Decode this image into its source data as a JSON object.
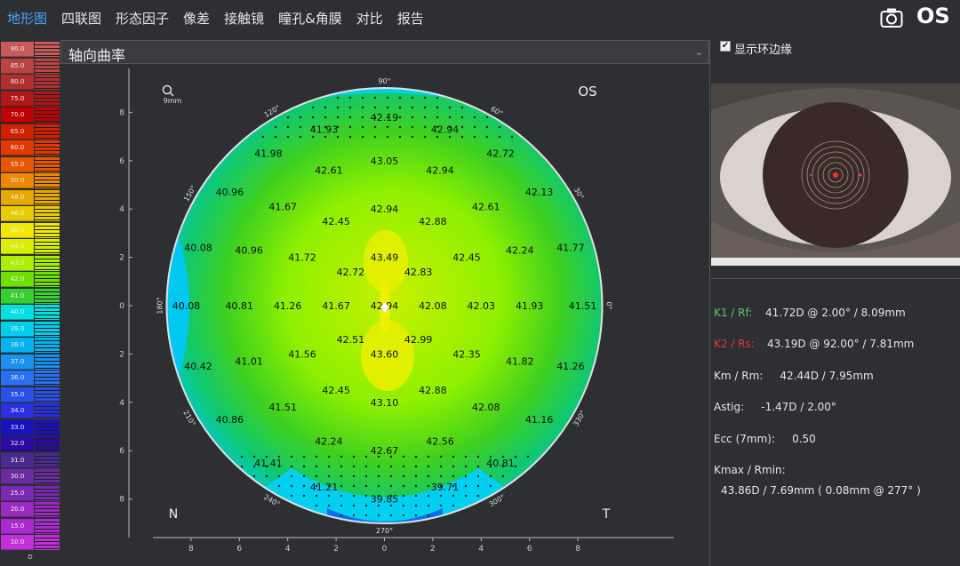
{
  "tabs": [
    "地形图",
    "四联图",
    "形态因子",
    "像差",
    "接触镜",
    "瞳孔&角膜",
    "对比",
    "报告"
  ],
  "active_tab": 0,
  "eye": "OS",
  "scale": {
    "labels": [
      "90.0",
      "85.0",
      "80.0",
      "75.0",
      "70.0",
      "65.0",
      "60.0",
      "55.0",
      "50.0",
      "48.0",
      "46.0",
      "45.0",
      "44.0",
      "43.0",
      "42.0",
      "41.0",
      "40.0",
      "39.0",
      "38.0",
      "37.0",
      "36.0",
      "35.0",
      "34.0",
      "33.0",
      "32.0",
      "31.0",
      "30.0",
      "25.0",
      "20.0",
      "15.0",
      "10.0"
    ],
    "colors": [
      "#c85a5a",
      "#b84444",
      "#b03030",
      "#b01818",
      "#c00000",
      "#d02000",
      "#e03a00",
      "#e65800",
      "#ee8800",
      "#e8a800",
      "#e8cc00",
      "#f0e800",
      "#d8f000",
      "#a8f000",
      "#70e000",
      "#38d030",
      "#00e0e0",
      "#00d0f0",
      "#00b4f0",
      "#1a90f0",
      "#2a70f0",
      "#2a50e8",
      "#2a30e0",
      "#1a10c0",
      "#2a0aa0",
      "#4a2a90",
      "#6a2aa0",
      "#7a2ab0",
      "#9a2ac0",
      "#aa2ad0",
      "#c030d8"
    ],
    "unit": "D"
  },
  "map_type": "轴向曲率",
  "map": {
    "eye": "OS",
    "zoom_label": "9mm",
    "nasal": "N",
    "temporal": "T",
    "angle_labels": [
      "90°",
      "60°",
      "30°",
      "0°",
      "330°",
      "300°",
      "270°",
      "240°",
      "210°",
      "180°",
      "150°",
      "120°"
    ],
    "axis_ticks": [
      "8",
      "6",
      "4",
      "2",
      "0",
      "2",
      "4",
      "6",
      "8"
    ],
    "values": [
      {
        "v": "42.19",
        "x": 0.0,
        "y": 7.8
      },
      {
        "v": "41.93",
        "x": -2.5,
        "y": 7.3
      },
      {
        "v": "42.94",
        "x": 2.5,
        "y": 7.3
      },
      {
        "v": "41.98",
        "x": -4.8,
        "y": 6.3
      },
      {
        "v": "42.72",
        "x": 4.8,
        "y": 6.3
      },
      {
        "v": "43.05",
        "x": 0.0,
        "y": 6.0
      },
      {
        "v": "42.61",
        "x": -2.3,
        "y": 5.6
      },
      {
        "v": "42.94",
        "x": 2.3,
        "y": 5.6
      },
      {
        "v": "40.96",
        "x": -6.4,
        "y": 4.7
      },
      {
        "v": "42.13",
        "x": 6.4,
        "y": 4.7
      },
      {
        "v": "41.67",
        "x": -4.2,
        "y": 4.1
      },
      {
        "v": "42.61",
        "x": 4.2,
        "y": 4.1
      },
      {
        "v": "42.94",
        "x": 0.0,
        "y": 4.0
      },
      {
        "v": "42.45",
        "x": -2.0,
        "y": 3.5
      },
      {
        "v": "42.88",
        "x": 2.0,
        "y": 3.5
      },
      {
        "v": "40.08",
        "x": -7.7,
        "y": 2.4
      },
      {
        "v": "40.96",
        "x": -5.6,
        "y": 2.3
      },
      {
        "v": "41.72",
        "x": -3.4,
        "y": 2.0
      },
      {
        "v": "43.49",
        "x": 0.0,
        "y": 2.0
      },
      {
        "v": "42.45",
        "x": 3.4,
        "y": 2.0
      },
      {
        "v": "42.24",
        "x": 5.6,
        "y": 2.3
      },
      {
        "v": "41.77",
        "x": 7.7,
        "y": 2.4
      },
      {
        "v": "42.72",
        "x": -1.4,
        "y": 1.4
      },
      {
        "v": "42.83",
        "x": 1.4,
        "y": 1.4
      },
      {
        "v": "40.08",
        "x": -8.2,
        "y": 0.0
      },
      {
        "v": "40.81",
        "x": -6.0,
        "y": 0.0
      },
      {
        "v": "41.26",
        "x": -4.0,
        "y": 0.0
      },
      {
        "v": "41.67",
        "x": -2.0,
        "y": 0.0
      },
      {
        "v": "42.94",
        "x": 0.0,
        "y": 0.0
      },
      {
        "v": "42.08",
        "x": 2.0,
        "y": 0.0
      },
      {
        "v": "42.03",
        "x": 4.0,
        "y": 0.0
      },
      {
        "v": "41.93",
        "x": 6.0,
        "y": 0.0
      },
      {
        "v": "41.51",
        "x": 8.2,
        "y": 0.0
      },
      {
        "v": "42.51",
        "x": -1.4,
        "y": -1.4
      },
      {
        "v": "42.99",
        "x": 1.4,
        "y": -1.4
      },
      {
        "v": "41.56",
        "x": -3.4,
        "y": -2.0
      },
      {
        "v": "43.60",
        "x": 0.0,
        "y": -2.0
      },
      {
        "v": "42.35",
        "x": 3.4,
        "y": -2.0
      },
      {
        "v": "40.42",
        "x": -7.7,
        "y": -2.5
      },
      {
        "v": "41.01",
        "x": -5.6,
        "y": -2.3
      },
      {
        "v": "41.82",
        "x": 5.6,
        "y": -2.3
      },
      {
        "v": "41.26",
        "x": 7.7,
        "y": -2.5
      },
      {
        "v": "42.45",
        "x": -2.0,
        "y": -3.5
      },
      {
        "v": "42.88",
        "x": 2.0,
        "y": -3.5
      },
      {
        "v": "43.10",
        "x": 0.0,
        "y": -4.0
      },
      {
        "v": "41.51",
        "x": -4.2,
        "y": -4.2
      },
      {
        "v": "42.08",
        "x": 4.2,
        "y": -4.2
      },
      {
        "v": "40.86",
        "x": -6.4,
        "y": -4.7
      },
      {
        "v": "41.16",
        "x": 6.4,
        "y": -4.7
      },
      {
        "v": "42.24",
        "x": -2.3,
        "y": -5.6
      },
      {
        "v": "42.56",
        "x": 2.3,
        "y": -5.6
      },
      {
        "v": "42.67",
        "x": 0.0,
        "y": -6.0
      },
      {
        "v": "41.41",
        "x": -4.8,
        "y": -6.5
      },
      {
        "v": "40.81",
        "x": 4.8,
        "y": -6.5
      },
      {
        "v": "41.21",
        "x": -2.5,
        "y": -7.5
      },
      {
        "v": "39.71",
        "x": 2.5,
        "y": -7.5
      },
      {
        "v": "39.85",
        "x": 0.0,
        "y": -8.0
      }
    ]
  },
  "show_rim": "显示环边缘",
  "stats": {
    "k1_label": "K1 / Rf:",
    "k1_value": "41.72D @ 2.00° / 8.09mm",
    "k2_label": "K2 / Rs:",
    "k2_value": "43.19D @ 92.00° / 7.81mm",
    "km": "Km / Rm:     42.44D / 7.95mm",
    "astig": "Astig:     -1.47D / 2.00°",
    "ecc": "Ecc (7mm):     0.50",
    "kmax_label": "Kmax / Rmin:",
    "kmax_value": "43.86D / 7.69mm ( 0.08mm @ 277° )"
  },
  "colors": {
    "active_tab": "#4aa3ff",
    "k1": "#5ec85e",
    "k2": "#e23a3a"
  }
}
